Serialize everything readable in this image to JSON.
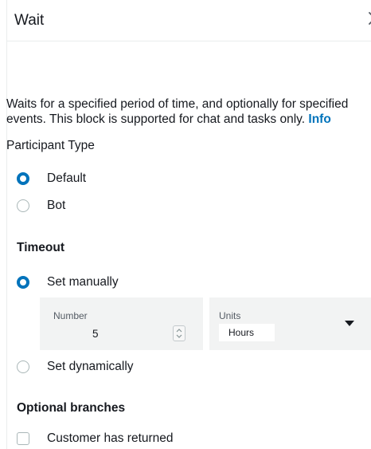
{
  "header": {
    "title": "Wait",
    "close_icon": "close-icon"
  },
  "description": {
    "text": "Waits for a specified period of time, and optionally for specified events. This block is supported for chat and tasks only.",
    "info_link": "Info"
  },
  "participant_type": {
    "label": "Participant Type",
    "options": [
      {
        "label": "Default",
        "selected": true
      },
      {
        "label": "Bot",
        "selected": false
      }
    ]
  },
  "timeout": {
    "heading": "Timeout",
    "options": [
      {
        "label": "Set manually",
        "selected": true
      },
      {
        "label": "Set dynamically",
        "selected": false
      }
    ],
    "number": {
      "label": "Number",
      "value": "5"
    },
    "units": {
      "label": "Units",
      "value": "Hours"
    }
  },
  "optional_branches": {
    "heading": "Optional branches",
    "options": [
      {
        "label": "Customer has returned",
        "checked": false
      }
    ]
  },
  "colors": {
    "accent": "#0073bb",
    "field_background": "#f2f3f3",
    "text": "#16191f"
  }
}
